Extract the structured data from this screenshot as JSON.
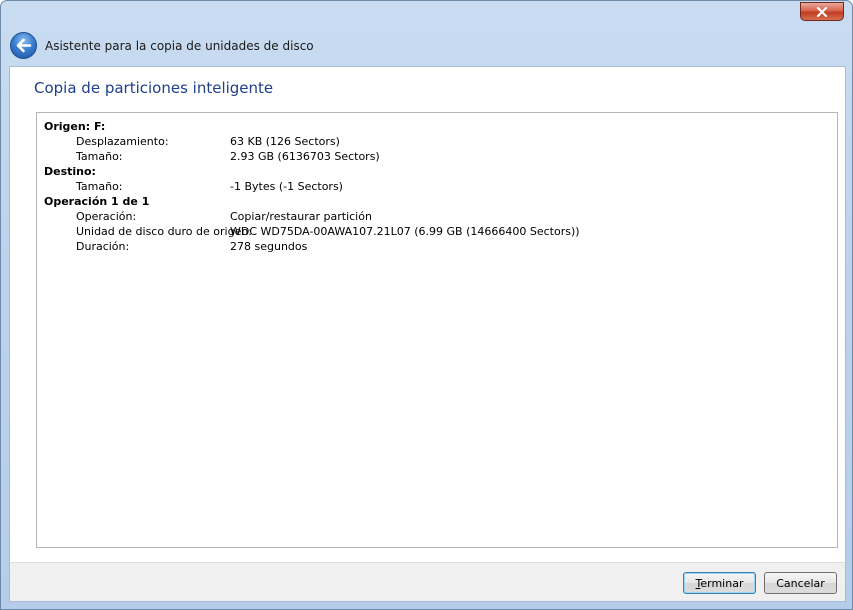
{
  "window": {
    "title": "Asistente para la copia de unidades de disco"
  },
  "page": {
    "heading": "Copia de particiones inteligente"
  },
  "details": {
    "origin": {
      "header": "Origen: F:",
      "rows": [
        {
          "label": "Desplazamiento:",
          "value": "63 KB (126 Sectors)"
        },
        {
          "label": "Tamaño:",
          "value": "2.93 GB (6136703 Sectors)"
        }
      ]
    },
    "destination": {
      "header": "Destino:",
      "rows": [
        {
          "label": "Tamaño:",
          "value": "-1 Bytes (-1 Sectors)"
        }
      ]
    },
    "operation": {
      "header": "Operación 1 de 1",
      "rows": [
        {
          "label": "Operación:",
          "value": "Copiar/restaurar partición"
        },
        {
          "label": "Unidad de disco duro de origen:",
          "value": "WDC WD75DA-00AWA107.21L07 (6.99 GB (14666400 Sectors))"
        },
        {
          "label": "Duración:",
          "value": "278 segundos"
        }
      ]
    }
  },
  "buttons": {
    "finish": "Terminar",
    "cancel": "Cancelar"
  },
  "icons": {
    "close": "close-icon",
    "back": "back-arrow-icon"
  },
  "colors": {
    "heading": "#1f3f8c",
    "close_button": "#c13b22",
    "back_button": "#3b7fd1"
  }
}
